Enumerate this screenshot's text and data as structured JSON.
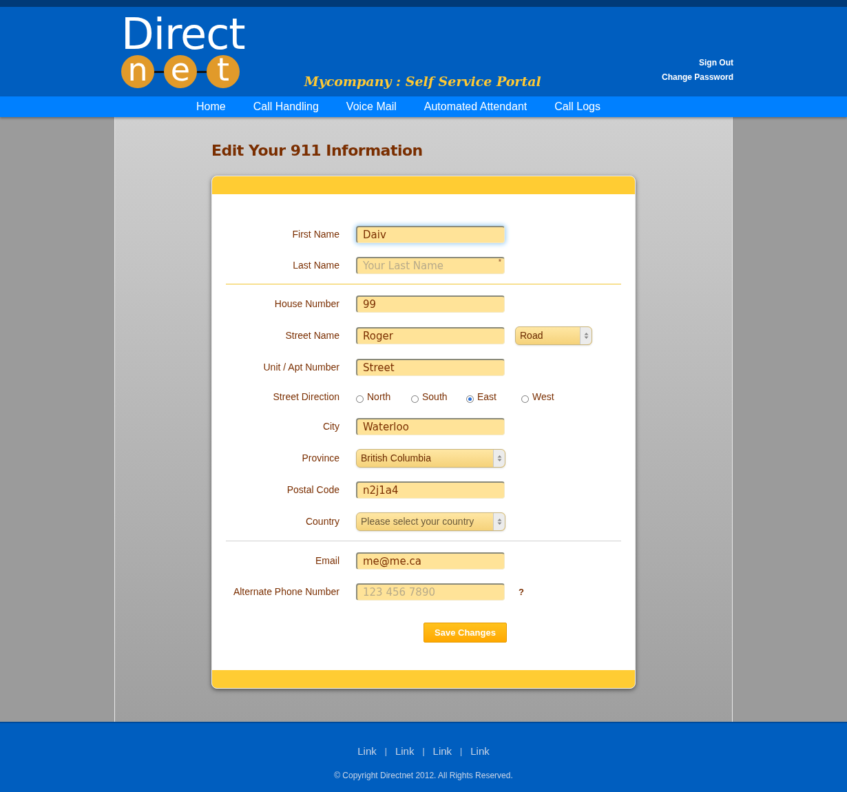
{
  "header": {
    "logo": {
      "word": "Direct",
      "letters": [
        "n",
        "e",
        "t"
      ]
    },
    "portal_title": "Mycompany : Self Service Portal",
    "account_links": [
      "Sign Out",
      "Change Password"
    ]
  },
  "nav": [
    "Home",
    "Call Handling",
    "Voice Mail",
    "Automated Attendant",
    "Call Logs"
  ],
  "page_title": "Edit Your 911 Information",
  "form": {
    "sections": [
      {
        "rows": [
          {
            "kind": "text",
            "label": "First Name",
            "value": "Daiv",
            "focused": true
          },
          {
            "kind": "text",
            "label": "Last Name",
            "placeholder": "Your Last Name",
            "mark": "*",
            "focused": false
          }
        ]
      },
      {
        "rows": [
          {
            "kind": "text",
            "label": "House Number",
            "value": "99",
            "focused": false
          },
          {
            "kind": "text",
            "label": "Street Name",
            "value": "Roger",
            "focused": false,
            "extra_select": "Road"
          },
          {
            "kind": "text",
            "label": "Unit / Apt Number",
            "value": "Street",
            "focused": false
          },
          {
            "kind": "radio",
            "label": "Street Direction",
            "options": [
              {
                "label": "North",
                "selected": false
              },
              {
                "label": "South",
                "selected": false
              },
              {
                "label": "East",
                "selected": true
              },
              {
                "label": "West",
                "selected": false
              }
            ]
          },
          {
            "kind": "text",
            "label": "City",
            "value": "Waterloo",
            "focused": false
          },
          {
            "kind": "select",
            "label": "Province",
            "value": "British Columbia"
          },
          {
            "kind": "text",
            "label": "Postal Code",
            "value": "n2j1a4",
            "focused": false
          },
          {
            "kind": "select",
            "label": "Country",
            "placeholder": "Please select your country"
          }
        ]
      },
      {
        "rows": [
          {
            "kind": "text",
            "label": "Email",
            "value": "me@me.ca",
            "focused": false
          },
          {
            "kind": "text",
            "label": "Alternate Phone Number",
            "placeholder": "123 456 7890",
            "focused": false,
            "help": "?"
          }
        ]
      }
    ],
    "submit": "Save Changes"
  },
  "footer": {
    "links": [
      "Link",
      "Link",
      "Link",
      "Link"
    ],
    "separator": "|",
    "copyright": "© Copyright Directnet 2012. All Rights Reserved."
  }
}
